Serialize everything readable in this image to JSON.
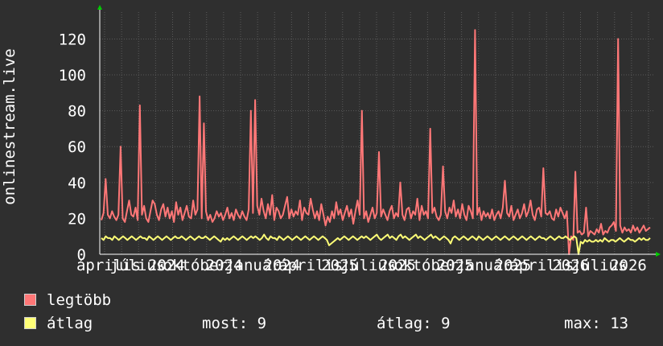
{
  "chart_data": {
    "type": "line",
    "ylabel": "onlinestream.live",
    "ylim": [
      0,
      135
    ],
    "yticks": [
      0,
      20,
      40,
      60,
      80,
      100,
      120
    ],
    "x_tick_labels": [
      "április",
      "július",
      "2024",
      "október",
      "2024",
      "január",
      "2024",
      "április",
      "2025",
      "július",
      "2025",
      "október",
      "2025",
      "január",
      "2025",
      "április",
      "2026",
      "július",
      "2026"
    ],
    "grid": true,
    "colors": {
      "background": "#2f2f2f",
      "plot_area": "#2f2f2f",
      "grid": "#5a5a5a",
      "axis": "#ffffff",
      "max_series": "#ff7777",
      "avg_series": "#ffff77",
      "arrow": "#00cc00"
    },
    "series": [
      {
        "name": "legtöbb",
        "color": "#ff7777",
        "values": [
          19,
          23,
          42,
          22,
          20,
          24,
          21,
          19,
          22,
          60,
          20,
          18,
          24,
          30,
          22,
          21,
          26,
          19,
          83,
          22,
          27,
          20,
          18,
          24,
          30,
          28,
          22,
          19,
          25,
          28,
          21,
          26,
          20,
          24,
          18,
          29,
          22,
          26,
          19,
          23,
          27,
          21,
          20,
          30,
          22,
          25,
          88,
          20,
          73,
          24,
          19,
          22,
          18,
          20,
          24,
          21,
          23,
          19,
          22,
          26,
          20,
          23,
          19,
          25,
          22,
          20,
          24,
          21,
          19,
          25,
          80,
          23,
          86,
          27,
          22,
          31,
          24,
          20,
          28,
          22,
          33,
          19,
          26,
          24,
          20,
          22,
          27,
          32,
          20,
          25,
          21,
          24,
          22,
          30,
          19,
          26,
          23,
          22,
          31,
          25,
          20,
          24,
          19,
          28,
          22,
          16,
          21,
          18,
          24,
          20,
          29,
          22,
          25,
          19,
          23,
          27,
          21,
          25,
          17,
          24,
          30,
          22,
          80,
          20,
          24,
          18,
          22,
          26,
          20,
          23,
          57,
          21,
          25,
          22,
          19,
          24,
          27,
          20,
          23,
          21,
          40,
          22,
          19,
          25,
          26,
          20,
          24,
          22,
          31,
          19,
          27,
          22,
          24,
          20,
          70,
          23,
          26,
          21,
          19,
          22,
          49,
          24,
          20,
          26,
          23,
          30,
          21,
          25,
          20,
          28,
          22,
          19,
          27,
          24,
          20,
          125,
          22,
          26,
          19,
          24,
          21,
          23,
          20,
          25,
          19,
          22,
          24,
          20,
          26,
          41,
          23,
          21,
          27,
          19,
          22,
          25,
          20,
          23,
          28,
          21,
          24,
          30,
          22,
          19,
          25,
          26,
          21,
          48,
          23,
          22,
          24,
          20,
          19,
          25,
          21,
          26,
          23,
          20,
          24,
          0,
          10,
          8,
          46,
          12,
          13,
          11,
          12,
          26,
          10,
          13,
          12,
          11,
          14,
          12,
          17,
          11,
          13,
          12,
          15,
          16,
          18,
          13,
          120,
          16,
          12,
          15,
          13,
          14,
          12,
          16,
          13,
          15,
          12,
          14,
          16,
          13,
          14,
          15
        ]
      },
      {
        "name": "átlag",
        "color": "#ffff77",
        "values": [
          9,
          8,
          10,
          9,
          9,
          8,
          10,
          9,
          8,
          9,
          10,
          9,
          8,
          9,
          10,
          9,
          8,
          9,
          10,
          9,
          9,
          8,
          10,
          9,
          8,
          9,
          10,
          9,
          8,
          9,
          10,
          9,
          8,
          9,
          10,
          9,
          9,
          10,
          9,
          8,
          9,
          10,
          9,
          8,
          9,
          10,
          9,
          9,
          10,
          9,
          8,
          9,
          10,
          9,
          8,
          7,
          9,
          8,
          9,
          8,
          9,
          10,
          9,
          8,
          9,
          10,
          9,
          8,
          9,
          10,
          9,
          10,
          9,
          8,
          9,
          11,
          9,
          8,
          10,
          9,
          9,
          8,
          10,
          9,
          8,
          9,
          10,
          9,
          8,
          9,
          10,
          9,
          8,
          9,
          10,
          9,
          8,
          9,
          10,
          9,
          8,
          9,
          10,
          9,
          8,
          5,
          6,
          7,
          8,
          9,
          8,
          9,
          10,
          9,
          8,
          9,
          10,
          9,
          8,
          9,
          10,
          9,
          10,
          9,
          8,
          9,
          10,
          11,
          9,
          8,
          9,
          10,
          11,
          9,
          10,
          9,
          8,
          10,
          11,
          9,
          10,
          9,
          8,
          9,
          10,
          11,
          9,
          10,
          9,
          8,
          9,
          10,
          11,
          9,
          10,
          9,
          8,
          9,
          10,
          9,
          8,
          6,
          9,
          10,
          9,
          8,
          9,
          10,
          9,
          8,
          9,
          10,
          9,
          8,
          10,
          9,
          8,
          9,
          10,
          9,
          8,
          9,
          10,
          9,
          8,
          9,
          10,
          9,
          8,
          9,
          10,
          9,
          8,
          9,
          10,
          9,
          8,
          9,
          10,
          9,
          8,
          9,
          10,
          9,
          9,
          8,
          9,
          10,
          9,
          8,
          9,
          10,
          9,
          9,
          10,
          9,
          8,
          9,
          10,
          9,
          0,
          7,
          6,
          8,
          7,
          8,
          7,
          7,
          8,
          7,
          8,
          7,
          9,
          8,
          7,
          8,
          8,
          7,
          8,
          9,
          8,
          7,
          8,
          9,
          8,
          8,
          7,
          8,
          9,
          8,
          9,
          8,
          8,
          9
        ]
      }
    ]
  },
  "legend": {
    "max_label": "legtöbb",
    "avg_label": "átlag",
    "now_label": "most:",
    "now_value": "9",
    "avg_stat_label": "átlag:",
    "avg_stat_value": "9",
    "max_stat_label": "max:",
    "max_stat_value": "13"
  }
}
